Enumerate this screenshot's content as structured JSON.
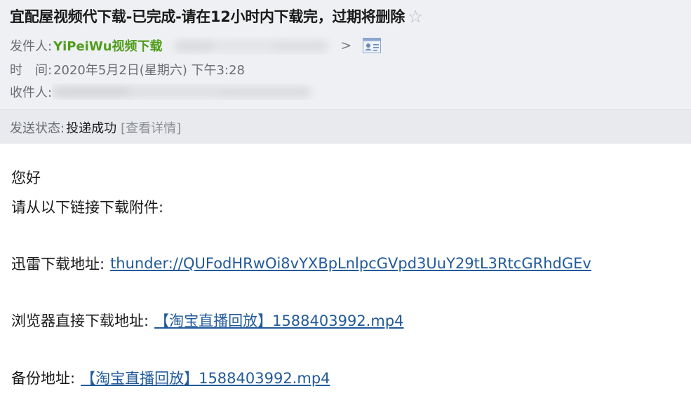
{
  "header": {
    "subject": "宜配屋视频代下载-已完成-请在12小时内下载完，过期将删除",
    "star_icon": "☆",
    "sender_label": "发件人:",
    "sender_name": "YiPeiWu视频下载",
    "sender_chevron": ">",
    "time_label": "时　间:",
    "time_value": "2020年5月2日(星期六) 下午3:28",
    "recipient_label": "收件人:",
    "status_label": "发送状态:",
    "status_value": "投递成功",
    "status_detail": "[查看详情]"
  },
  "body": {
    "greeting": "您好",
    "instruction": "请从以下链接下载附件:",
    "thunder_label": "迅雷下载地址:",
    "thunder_link": "thunder://QUFodHRwOi8vYXBpLnlpcGVpd3UuY29tL3RtcGRhdGEv",
    "browser_label": "浏览器直接下载地址:",
    "browser_link": "【淘宝直播回放】1588403992.mp4",
    "backup_label": "备份地址:",
    "backup_link": "【淘宝直播回放】1588403992.mp4"
  },
  "colors": {
    "header_bg": "#eff0f3",
    "sender_green": "#4f9d1c",
    "link_blue": "#215a9a",
    "label_gray": "#6a6d73"
  }
}
